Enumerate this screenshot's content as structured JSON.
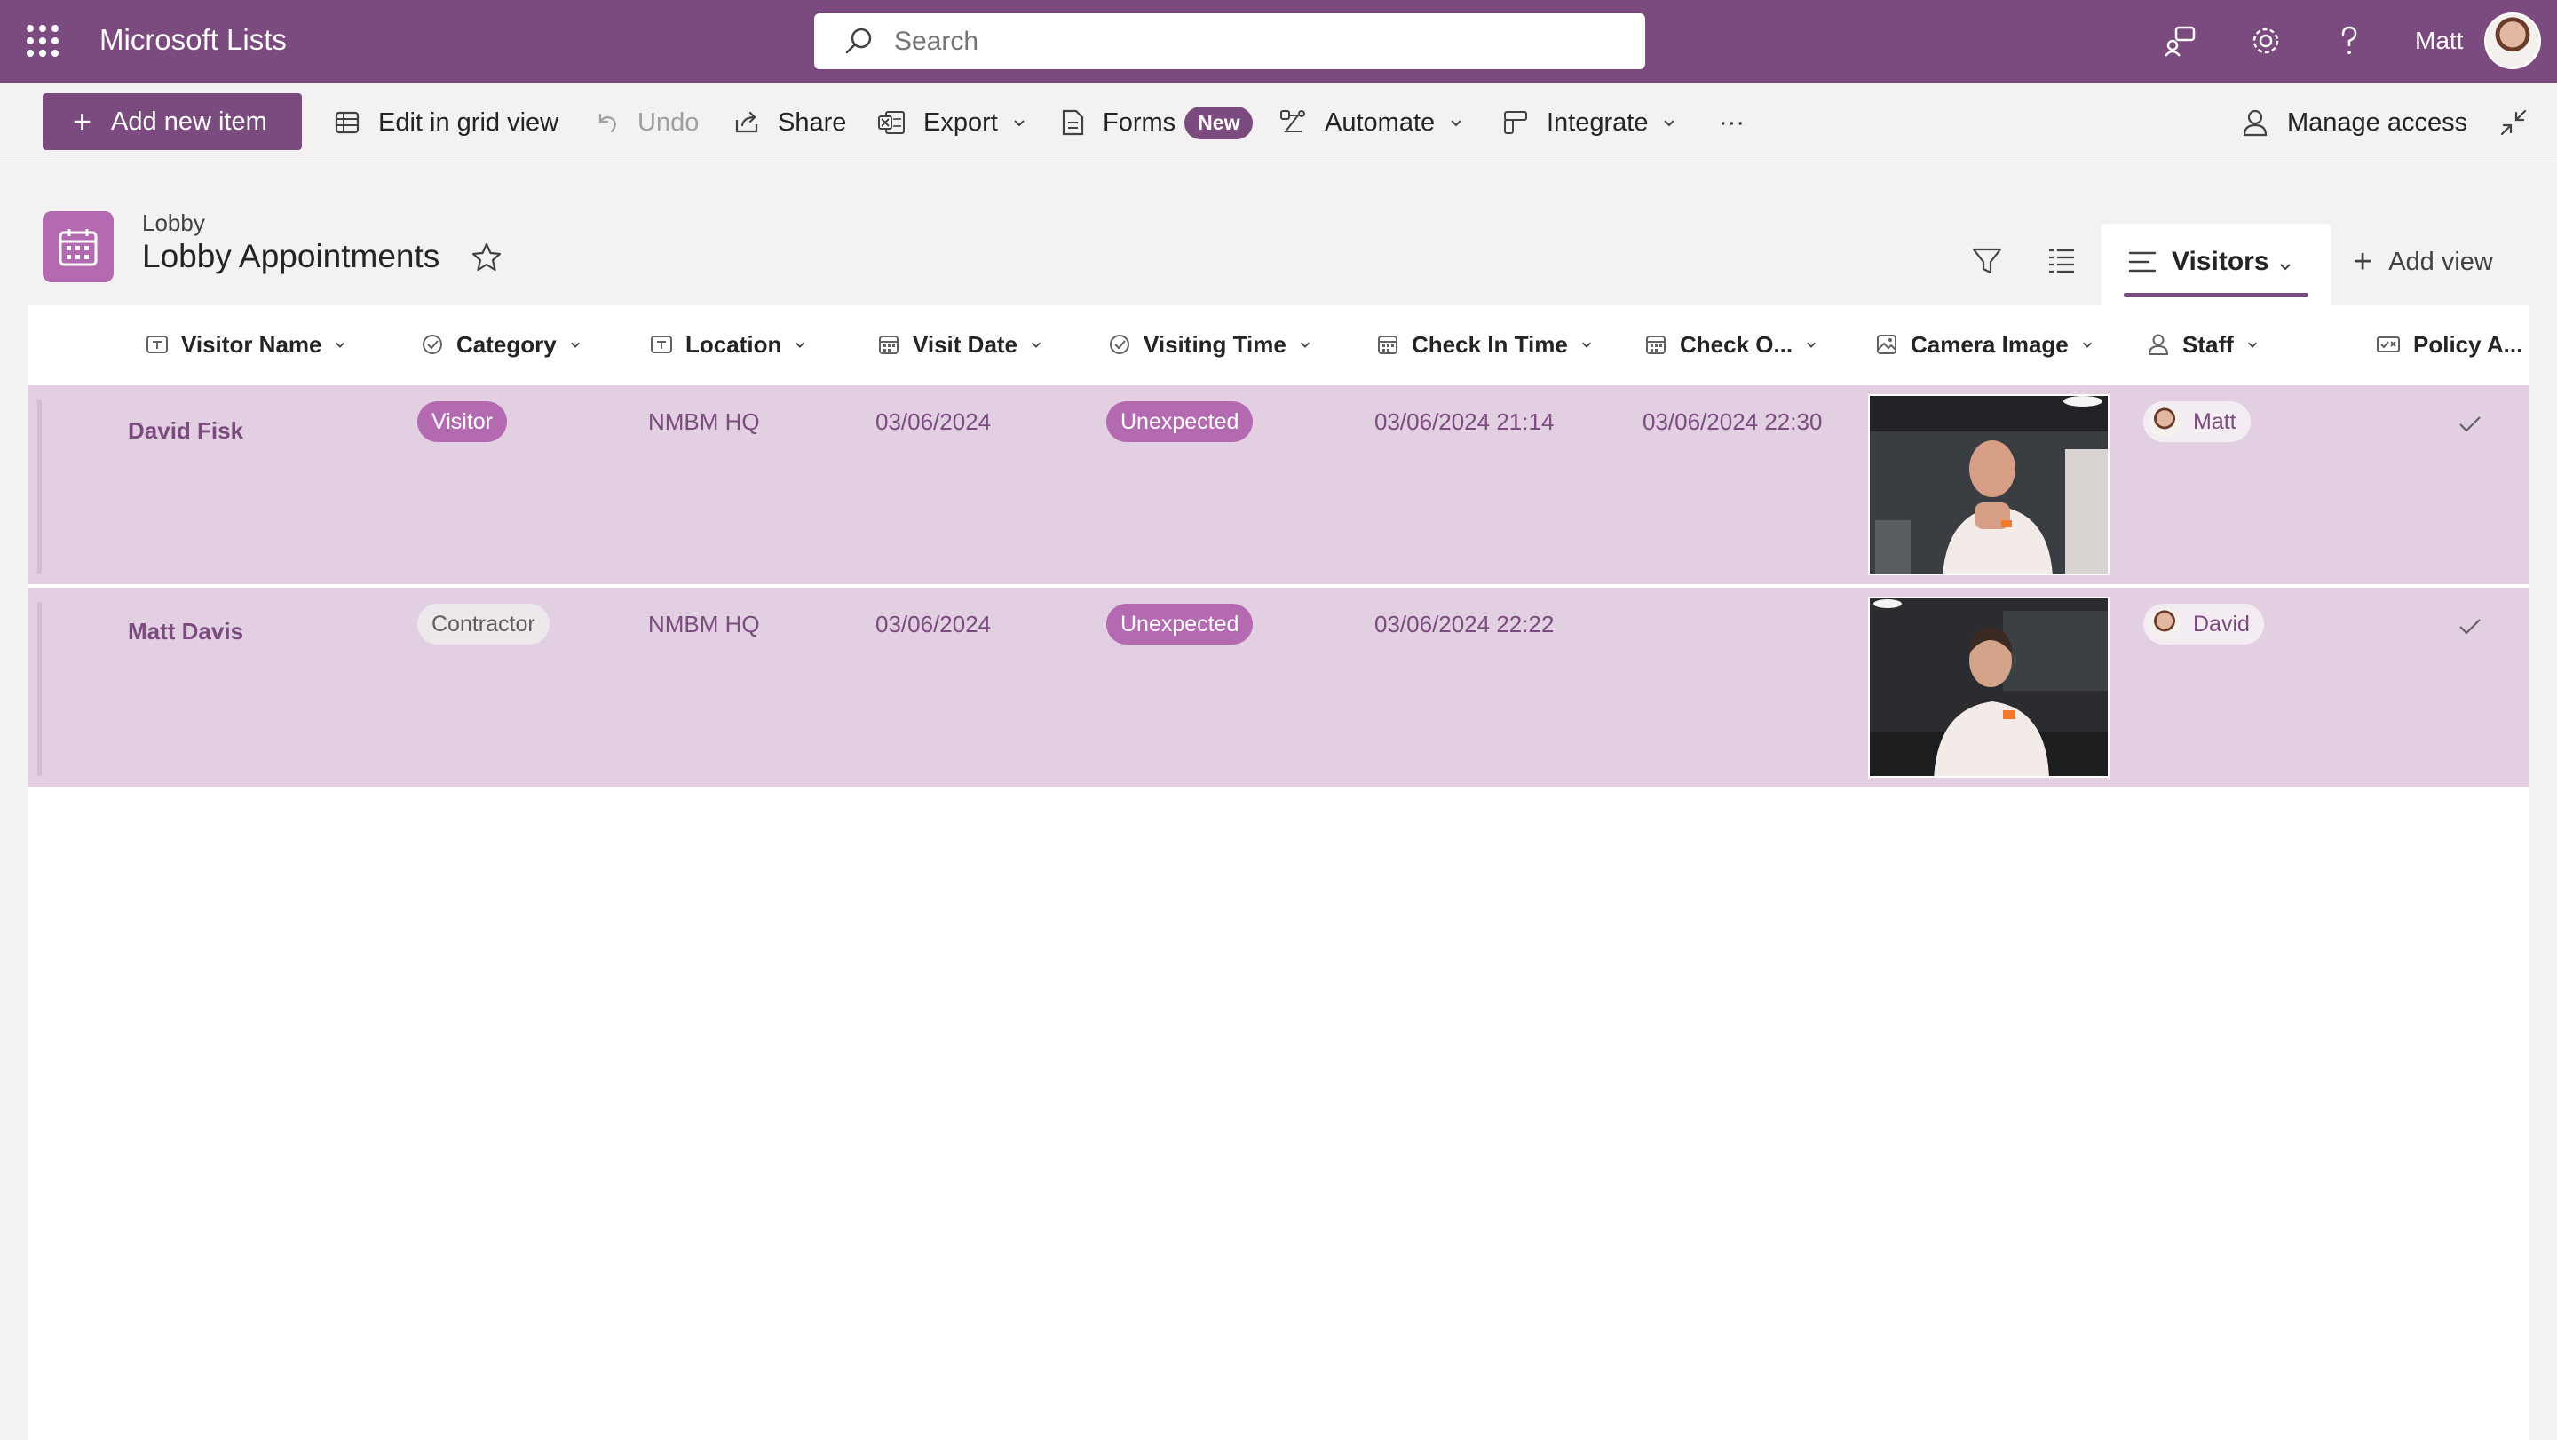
{
  "suitebar": {
    "app_title": "Microsoft Lists",
    "search_placeholder": "Search",
    "user_name": "Matt"
  },
  "commandbar": {
    "add_new_item": "Add new item",
    "edit_grid": "Edit in grid view",
    "undo": "Undo",
    "share": "Share",
    "export": "Export",
    "forms": "Forms",
    "forms_badge": "New",
    "automate": "Automate",
    "integrate": "Integrate",
    "more": "···",
    "manage_access": "Manage access"
  },
  "list": {
    "parent": "Lobby",
    "title": "Lobby Appointments",
    "view_name": "Visitors",
    "add_view": "Add view"
  },
  "columns": [
    {
      "label": "Visitor Name",
      "icon": "text-icon"
    },
    {
      "label": "Category",
      "icon": "choice-icon"
    },
    {
      "label": "Location",
      "icon": "text-icon"
    },
    {
      "label": "Visit Date",
      "icon": "calendar-icon"
    },
    {
      "label": "Visiting Time",
      "icon": "choice-icon"
    },
    {
      "label": "Check In Time",
      "icon": "calendar-icon"
    },
    {
      "label": "Check O...",
      "icon": "calendar-icon"
    },
    {
      "label": "Camera Image",
      "icon": "image-icon"
    },
    {
      "label": "Staff",
      "icon": "person-icon"
    },
    {
      "label": "Policy A...",
      "icon": "yesno-icon"
    }
  ],
  "rows": [
    {
      "visitor_name": "David Fisk",
      "category": "Visitor",
      "location": "NMBM HQ",
      "visit_date": "03/06/2024",
      "visiting_time": "Unexpected",
      "check_in": "03/06/2024 21:14",
      "check_out": "03/06/2024 22:30",
      "staff": "Matt",
      "policy_accepted": "yes"
    },
    {
      "visitor_name": "Matt Davis",
      "category": "Contractor",
      "location": "NMBM HQ",
      "visit_date": "03/06/2024",
      "visiting_time": "Unexpected",
      "check_in": "03/06/2024 22:22",
      "check_out": "",
      "staff": "David",
      "policy_accepted": "yes"
    }
  ],
  "colors": {
    "brand": "#7b4a7e",
    "accent_pill": "#b46ab1",
    "row_highlight": "#e2d0e2"
  }
}
